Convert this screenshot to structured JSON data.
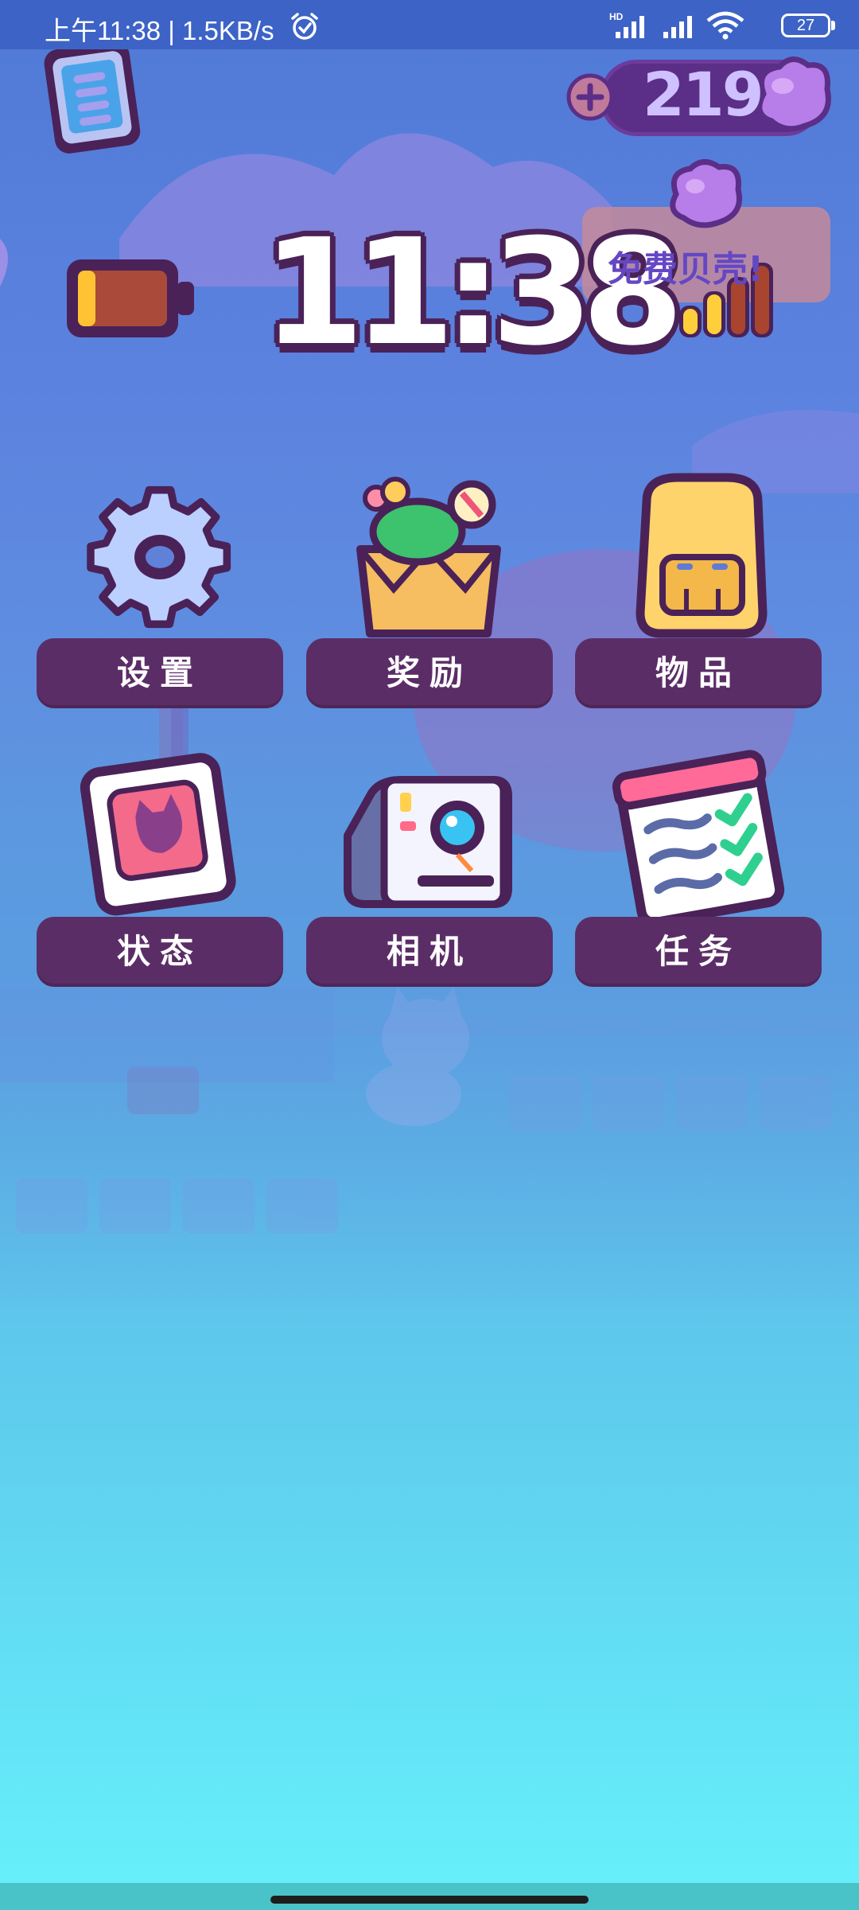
{
  "status_bar": {
    "time_and_speed": "上午11:38 | 1.5KB/s",
    "battery_level": "27",
    "icons": [
      "alarm-icon",
      "hd-signal-icon",
      "signal-icon",
      "wifi-icon",
      "battery-icon"
    ]
  },
  "hud": {
    "coin_count": "219",
    "free_shells_label": "免费贝壳!",
    "clock_time": "11:38"
  },
  "menu": {
    "items": [
      {
        "label": "设置",
        "icon": "gear-icon"
      },
      {
        "label": "奖励",
        "icon": "reward-box-icon"
      },
      {
        "label": "物品",
        "icon": "backpack-icon"
      },
      {
        "label": "状态",
        "icon": "status-card-icon"
      },
      {
        "label": "相机",
        "icon": "camera-icon"
      },
      {
        "label": "任务",
        "icon": "task-list-icon"
      }
    ]
  },
  "colors": {
    "label_bg": "#5b2d67",
    "outline": "#4a2258",
    "coin_pill": "#5b2e87",
    "gradient_top": "#4f7ad6",
    "gradient_bottom": "#66f1fb"
  }
}
